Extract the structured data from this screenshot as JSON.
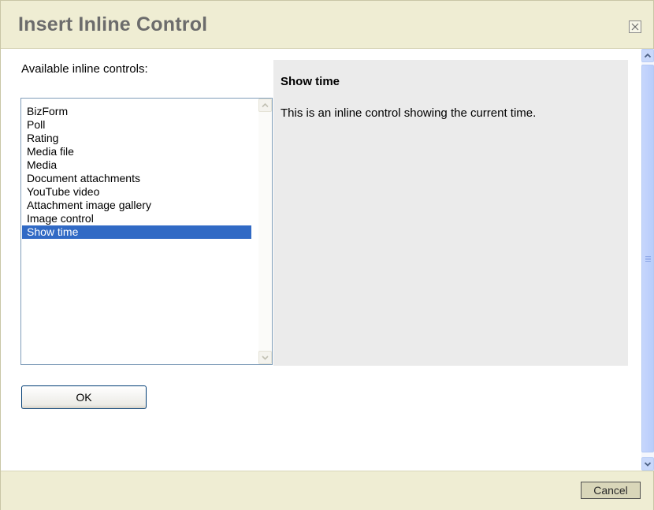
{
  "dialog": {
    "title": "Insert Inline Control",
    "close_icon": "close-box-icon"
  },
  "content": {
    "available_label": "Available inline controls:",
    "controls": [
      {
        "label": "BizForm",
        "selected": false
      },
      {
        "label": "Poll",
        "selected": false
      },
      {
        "label": "Rating",
        "selected": false
      },
      {
        "label": "Media file",
        "selected": false
      },
      {
        "label": "Media",
        "selected": false
      },
      {
        "label": "Document attachments",
        "selected": false
      },
      {
        "label": "YouTube video",
        "selected": false
      },
      {
        "label": "Attachment image gallery",
        "selected": false
      },
      {
        "label": "Image control",
        "selected": false
      },
      {
        "label": "Show time",
        "selected": true
      }
    ],
    "preview": {
      "title": "Show time",
      "description": "This is an inline control showing the current time."
    },
    "ok_label": "OK"
  },
  "footer": {
    "cancel_label": "Cancel"
  },
  "colors": {
    "chrome_bg": "#efedd3",
    "selection": "#316ac5",
    "preview_bg": "#ebebeb",
    "title_text": "#6c6c6c"
  }
}
